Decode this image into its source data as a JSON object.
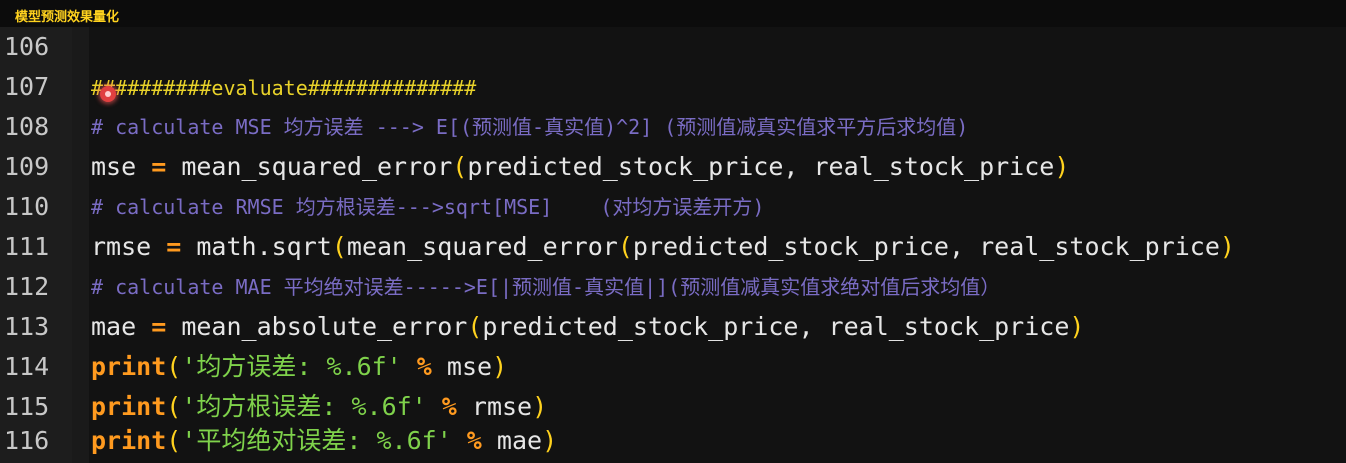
{
  "window": {
    "title": "模型预测效果量化"
  },
  "editor": {
    "lines": [
      {
        "number": "106",
        "code": ""
      },
      {
        "number": "107",
        "hash_before": "##########",
        "word": "evaluate",
        "hash_after": "##############"
      },
      {
        "number": "108",
        "comment": "# calculate MSE 均方误差 ---> E[(预测值-真实值)^2] (预测值减真实值求平方后求均值)"
      },
      {
        "number": "109",
        "var": "mse ",
        "eq": "=",
        "fn": " mean_squared_error",
        "open": "(",
        "args": "predicted_stock_price, real_stock_price",
        "close": ")"
      },
      {
        "number": "110",
        "comment": "# calculate RMSE 均方根误差--->sqrt[MSE]    (对均方误差开方)"
      },
      {
        "number": "111",
        "var": "rmse ",
        "eq": "=",
        "fn": " math.sqrt",
        "open1": "(",
        "fn2": "mean_squared_error",
        "open2": "(",
        "args": "predicted_stock_price, real_stock_price",
        "close": ")"
      },
      {
        "number": "112",
        "comment": "# calculate MAE 平均绝对误差----->E[|预测值-真实值|](预测值减真实值求绝对值后求均值）"
      },
      {
        "number": "113",
        "var": "mae ",
        "eq": "=",
        "fn": " mean_absolute_error",
        "open": "(",
        "args": "predicted_stock_price, real_stock_price",
        "close": ")"
      },
      {
        "number": "114",
        "kw": "print",
        "open": "(",
        "str": "'均方误差: %.6f'",
        "op": " % ",
        "arg": "mse",
        "close": ")"
      },
      {
        "number": "115",
        "kw": "print",
        "open": "(",
        "str": "'均方根误差: %.6f'",
        "op": " % ",
        "arg": "rmse",
        "close": ")"
      },
      {
        "number": "116",
        "kw": "print",
        "open": "(",
        "str": "'平均绝对误差: %.6f'",
        "op": " % ",
        "arg": "mae",
        "close": ")"
      }
    ]
  },
  "colors": {
    "background": "#121212",
    "gutter": "#1d1d1d",
    "comment": "#7a6cc4",
    "keyword": "#ff9a1f",
    "string": "#7fd24b",
    "title": "#ffd21e"
  }
}
